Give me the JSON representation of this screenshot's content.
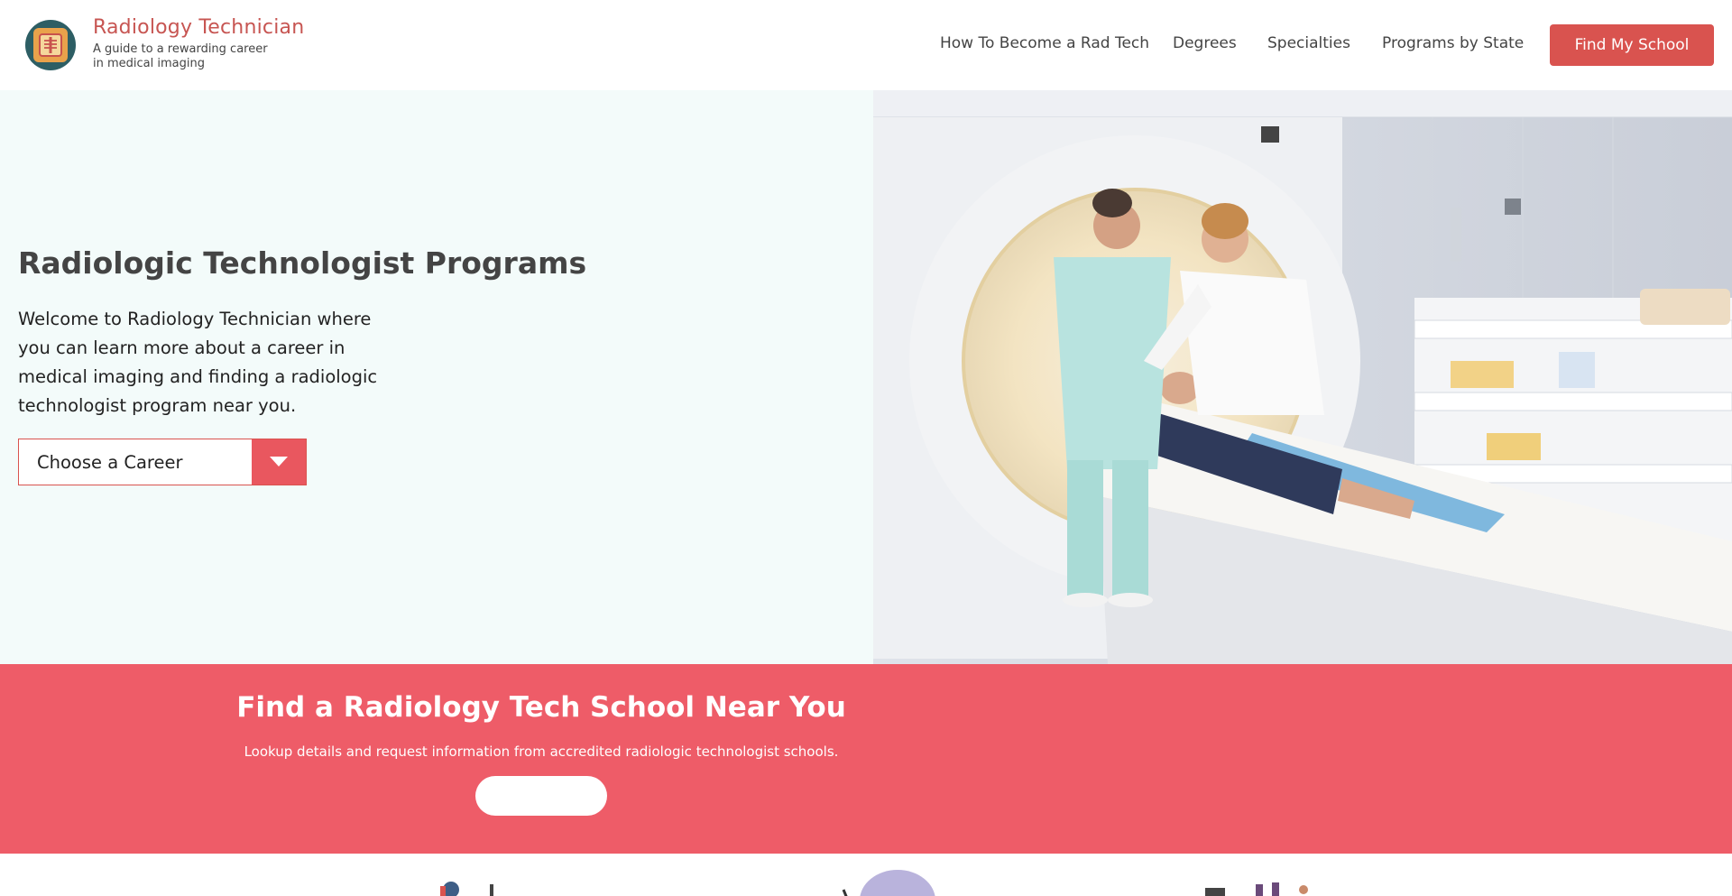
{
  "header": {
    "brand_title": "Radiology Technician",
    "brand_tagline_line1": "A guide to a rewarding career",
    "brand_tagline_line2": "in medical imaging",
    "nav": [
      {
        "label": "How To Become a Rad Tech"
      },
      {
        "label": "Degrees"
      },
      {
        "label": "Specialties"
      },
      {
        "label": "Programs by State"
      }
    ],
    "cta_label": "Find My School"
  },
  "hero": {
    "title": "Radiologic Technologist Programs",
    "text": "Welcome to Radiology Technician where you can learn more about a career in medical imaging and finding a radiologic technologist program near you.",
    "select_label": "Choose a Career"
  },
  "banner": {
    "title": "Find a Radiology Tech School Near You",
    "subtitle": "Lookup details and request information from accredited radiologic technologist schools.",
    "button_label": ""
  },
  "colors": {
    "accent": "#d9534f",
    "banner": "#ee5c68",
    "hero_bg": "#f3fbfa",
    "logo_bg": "#2d5e64"
  }
}
